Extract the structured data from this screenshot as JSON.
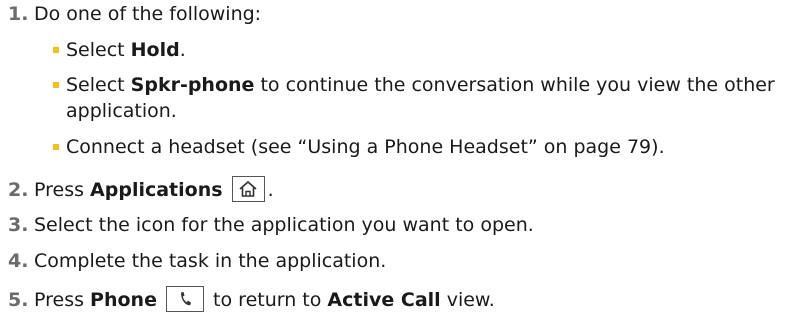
{
  "steps": [
    {
      "num": "1.",
      "text": "Do one of the following:"
    },
    {
      "num": "2.",
      "prefix": "Press ",
      "bold": "Applications",
      "suffix": "."
    },
    {
      "num": "3.",
      "text": "Select the icon for the application you want to open."
    },
    {
      "num": "4.",
      "text": "Complete the task in the application."
    },
    {
      "num": "5.",
      "prefix": "Press ",
      "bold": "Phone",
      "middle": " to return to ",
      "bold2": "Active Call",
      "suffix": " view."
    }
  ],
  "substeps": [
    {
      "prefix": "Select ",
      "bold": "Hold",
      "suffix": "."
    },
    {
      "prefix": "Select ",
      "bold": "Spkr-phone",
      "suffix": " to continue the conversation while you view the other",
      "line2": "application."
    },
    {
      "text": "Connect a headset (see “Using a Phone Headset” on page 79)."
    }
  ],
  "icons": {
    "step2_key": "home-icon",
    "step5_key": "phone-icon"
  },
  "colors": {
    "step_number": "#6b6b6b",
    "bullet": "#f2c018",
    "text": "#1a1a1a"
  }
}
